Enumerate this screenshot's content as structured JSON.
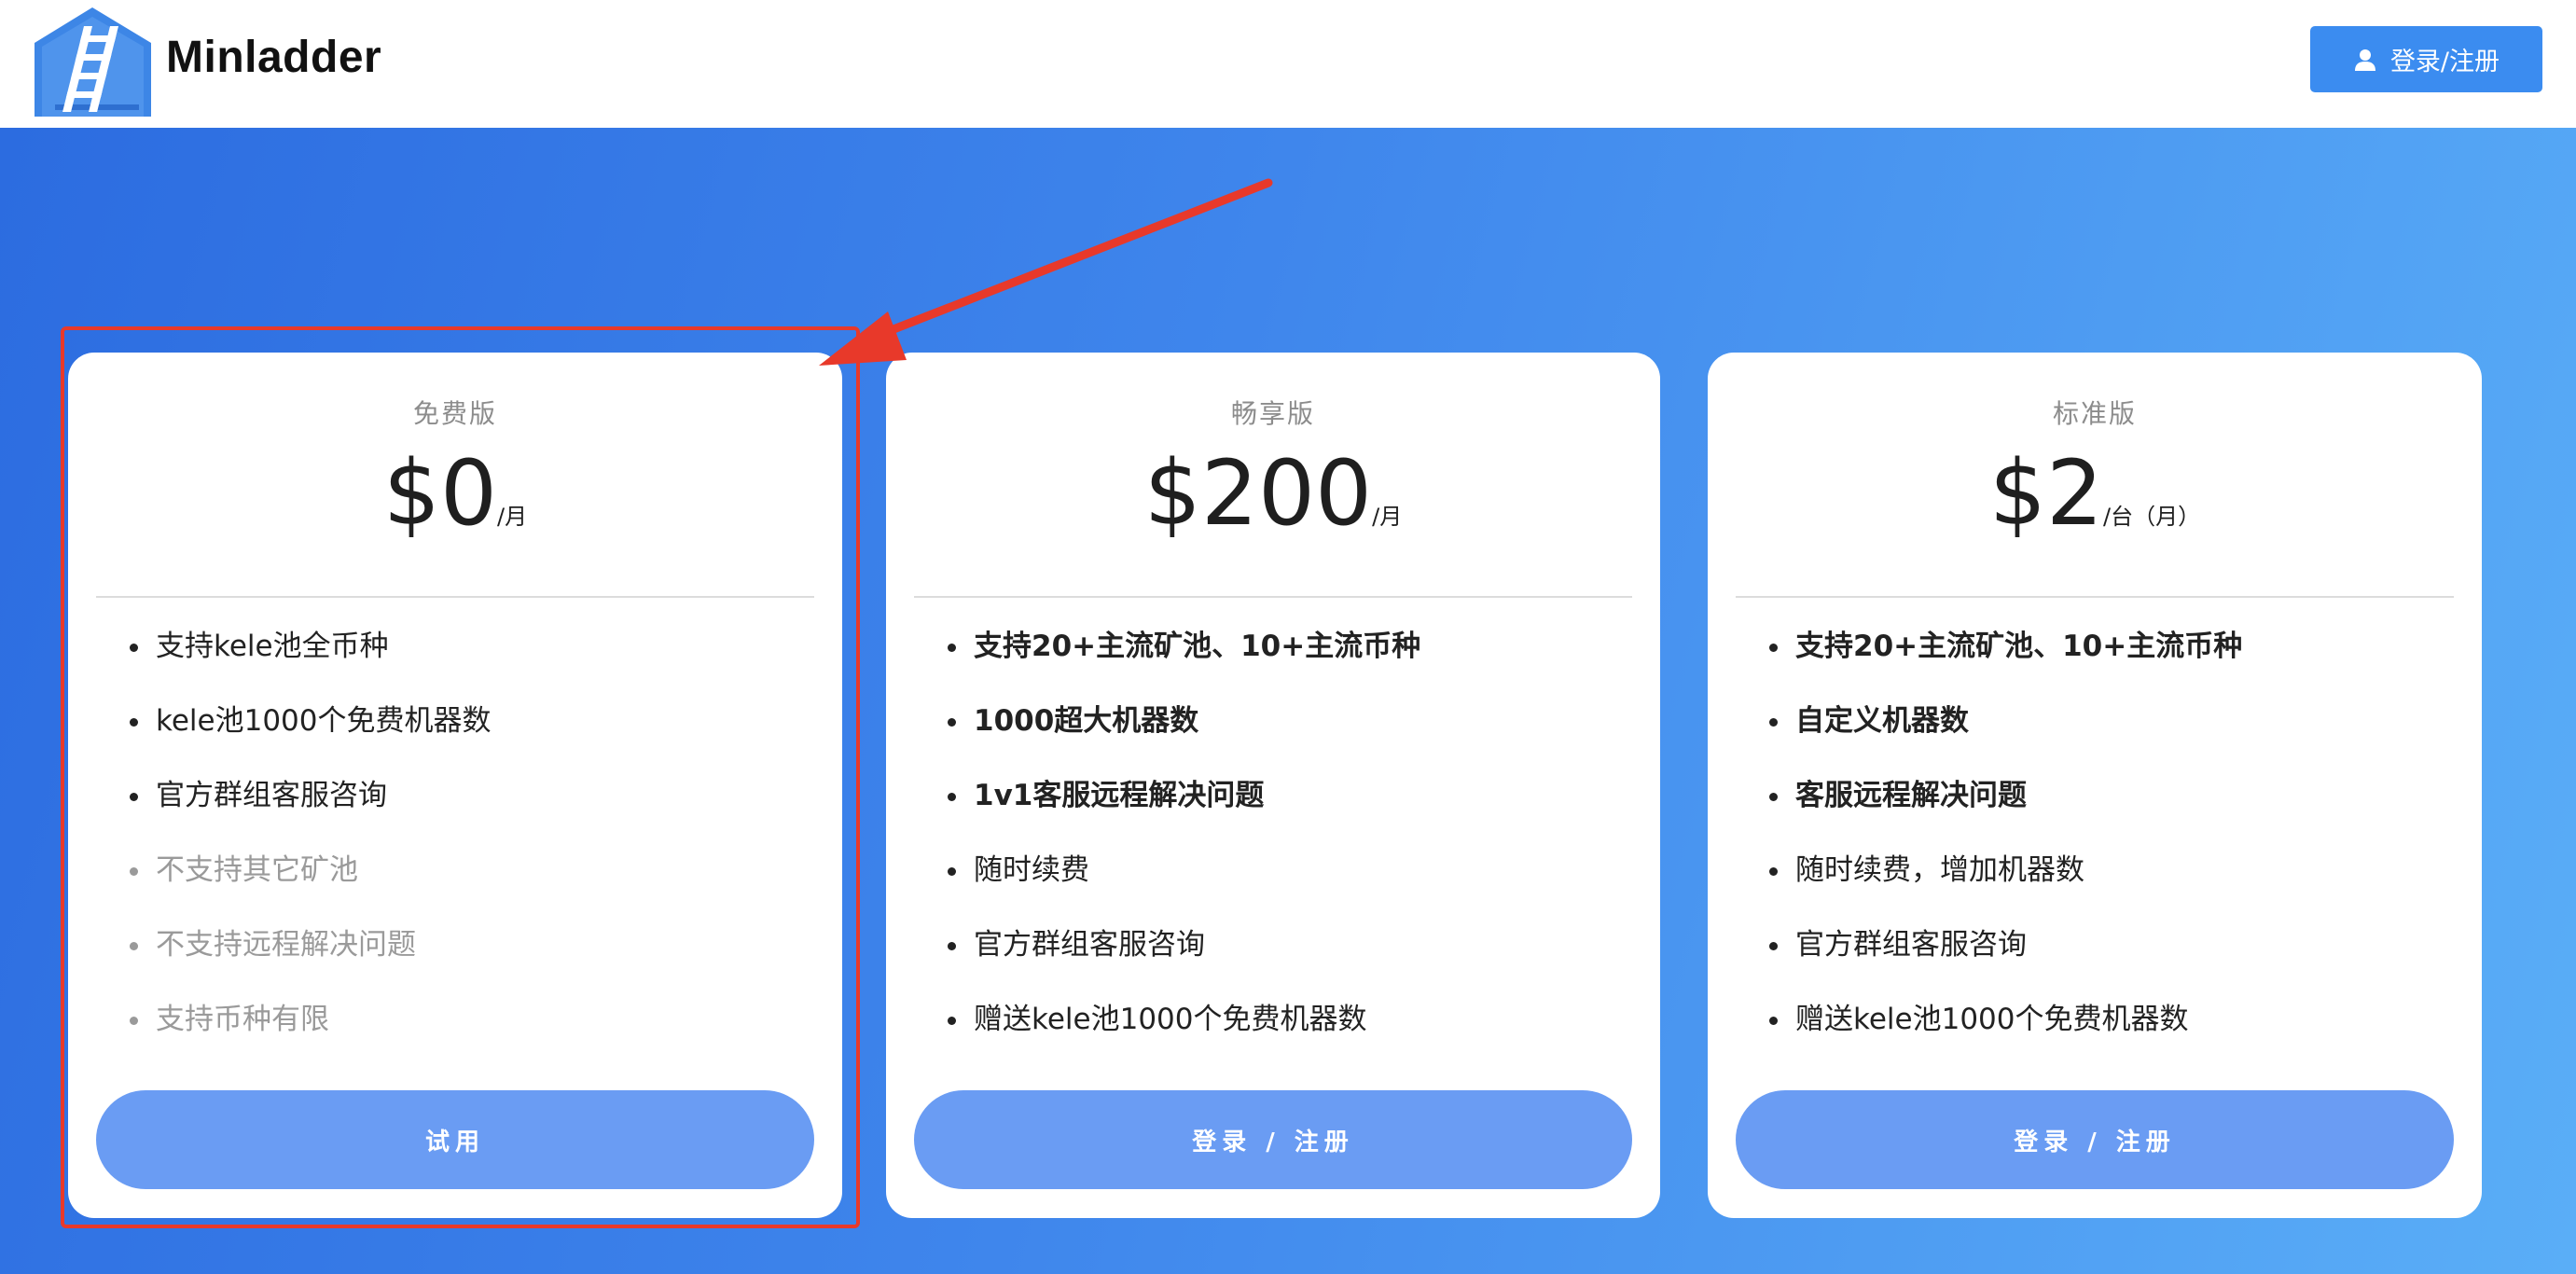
{
  "header": {
    "brand": "Minladder",
    "login_label": "登录/注册",
    "login_icon": "user-icon",
    "accent_color": "#3b8cf0"
  },
  "hero": {
    "gradient_start": "#2c6ce0",
    "gradient_end": "#5aaef7"
  },
  "plans": [
    {
      "name": "免费版",
      "price": "$0",
      "unit": "/月",
      "features": [
        {
          "text": "支持kele池全币种",
          "style": "normal"
        },
        {
          "text": "kele池1000个免费机器数",
          "style": "normal"
        },
        {
          "text": "官方群组客服咨询",
          "style": "normal"
        },
        {
          "text": "不支持其它矿池",
          "style": "muted"
        },
        {
          "text": "不支持远程解决问题",
          "style": "muted"
        },
        {
          "text": "支持币种有限",
          "style": "muted"
        }
      ],
      "button_label": "试用"
    },
    {
      "name": "畅享版",
      "price": "$200",
      "unit": "/月",
      "features": [
        {
          "text": "支持20+主流矿池、10+主流币种",
          "style": "bold"
        },
        {
          "text": "1000超大机器数",
          "style": "bold"
        },
        {
          "text": "1v1客服远程解决问题",
          "style": "bold"
        },
        {
          "text": "随时续费",
          "style": "normal"
        },
        {
          "text": "官方群组客服咨询",
          "style": "normal"
        },
        {
          "text": "赠送kele池1000个免费机器数",
          "style": "normal"
        }
      ],
      "button_label": "登录 / 注册"
    },
    {
      "name": "标准版",
      "price": "$2",
      "unit": "/台（月）",
      "features": [
        {
          "text": "支持20+主流矿池、10+主流币种",
          "style": "bold"
        },
        {
          "text": "自定义机器数",
          "style": "bold"
        },
        {
          "text": "客服远程解决问题",
          "style": "bold"
        },
        {
          "text": "随时续费，增加机器数",
          "style": "normal"
        },
        {
          "text": "官方群组客服咨询",
          "style": "normal"
        },
        {
          "text": "赠送kele池1000个免费机器数",
          "style": "normal"
        }
      ],
      "button_label": "登录 / 注册"
    }
  ],
  "annotation": {
    "color": "#e8392a",
    "highlight_plan": "免费版"
  }
}
